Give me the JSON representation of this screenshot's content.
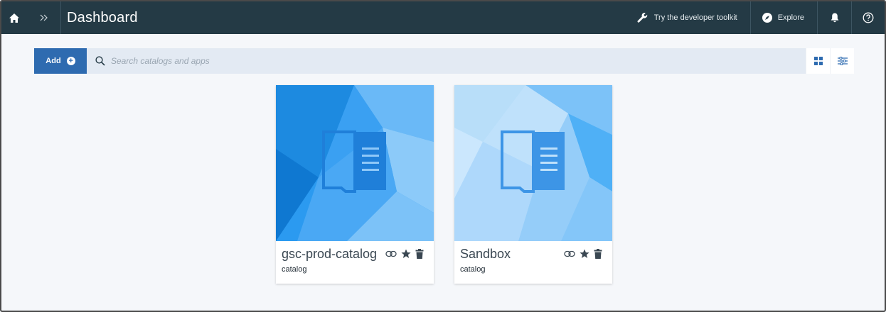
{
  "header": {
    "home_icon": "home-icon",
    "expand_icon": "double-chevron-right-icon",
    "title": "Dashboard",
    "toolkit_label": "Try the developer toolkit",
    "toolkit_icon": "wrench-icon",
    "explore_label": "Explore",
    "explore_icon": "compass-icon",
    "notifications_icon": "bell-icon",
    "help_icon": "help-icon"
  },
  "toolbar": {
    "add_label": "Add",
    "add_icon": "plus-circle-icon",
    "search_placeholder": "Search catalogs and apps",
    "search_icon": "search-icon",
    "grid_view_icon": "grid-icon",
    "filter_icon": "sliders-icon"
  },
  "cards": [
    {
      "name": "gsc-prod-catalog",
      "type": "catalog",
      "icons": [
        "link-icon",
        "star-icon",
        "trash-icon"
      ]
    },
    {
      "name": "Sandbox",
      "type": "catalog",
      "icons": [
        "link-icon",
        "star-icon",
        "trash-icon"
      ]
    }
  ],
  "colors": {
    "topbar": "#243a45",
    "primary": "#2e6bb0",
    "card1_accent": "#1e8fe6",
    "card2_accent": "#9fd2fb"
  }
}
